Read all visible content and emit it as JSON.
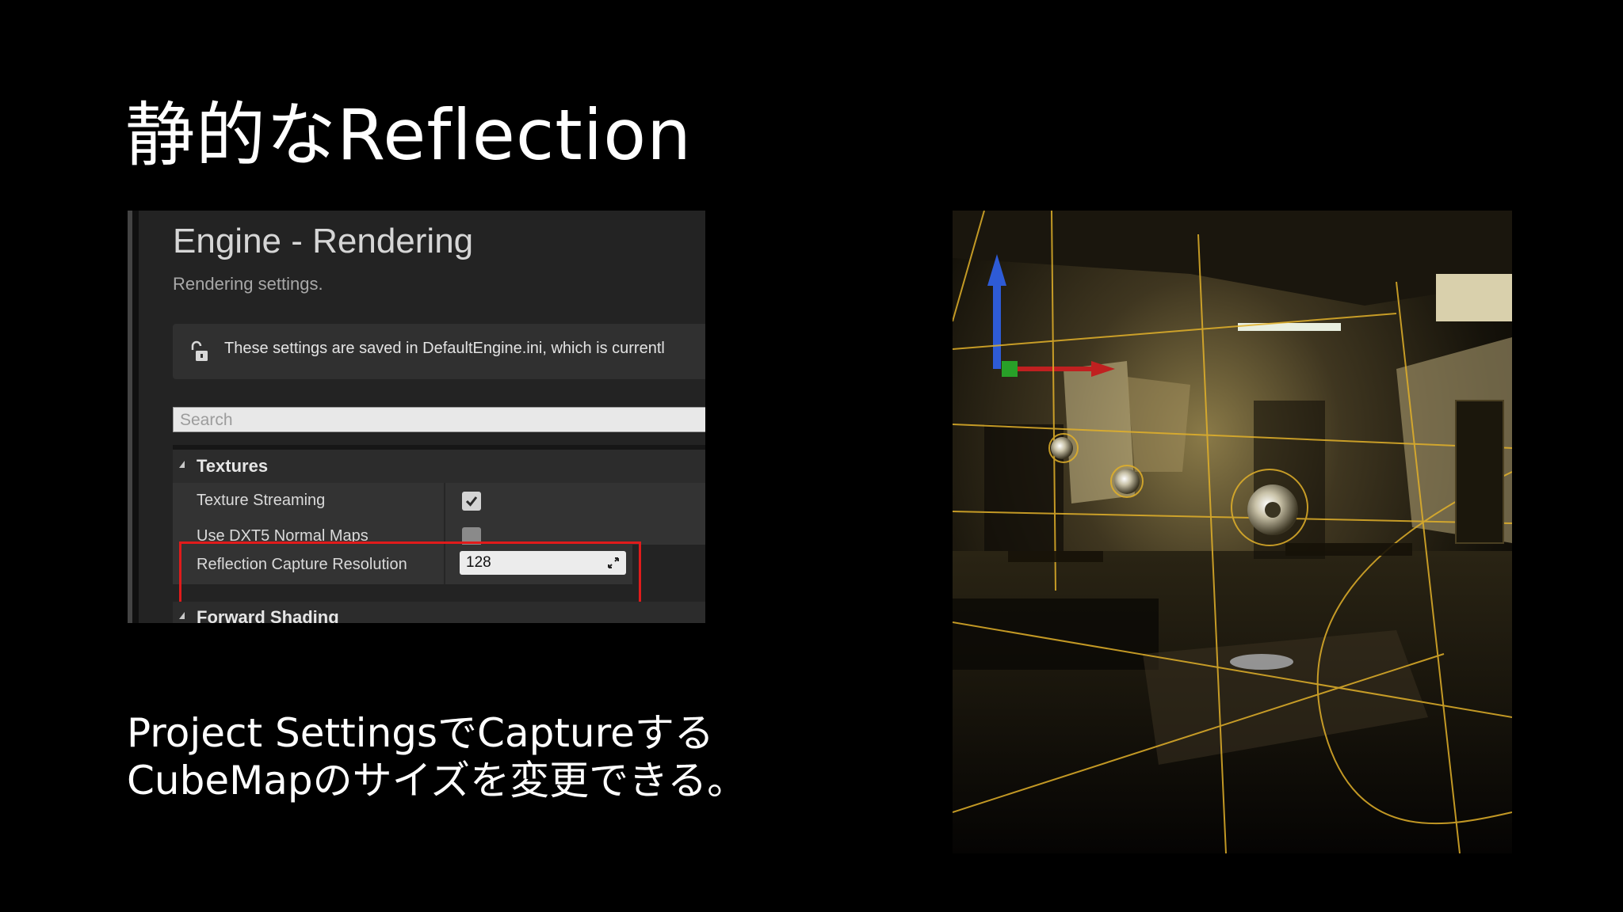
{
  "slide": {
    "title": "静的なReflection",
    "caption_line1": "Project SettingsでCaptureする",
    "caption_line2": "CubeMapのサイズを変更できる。"
  },
  "panel": {
    "title": "Engine - Rendering",
    "subtitle": "Rendering settings.",
    "notice": "These settings are saved in DefaultEngine.ini, which is currentl",
    "notice_icon": "unlock-icon",
    "search_placeholder": "Search",
    "section_textures": "Textures",
    "rows": [
      {
        "label": "Texture Streaming",
        "type": "checkbox",
        "checked": true
      },
      {
        "label": "Use DXT5 Normal Maps",
        "type": "checkbox",
        "checked": false
      },
      {
        "label": "Reflection Capture Resolution",
        "type": "number",
        "value": "128"
      }
    ],
    "section_forward": "Forward Shading",
    "highlight_color": "#e01b1b"
  }
}
